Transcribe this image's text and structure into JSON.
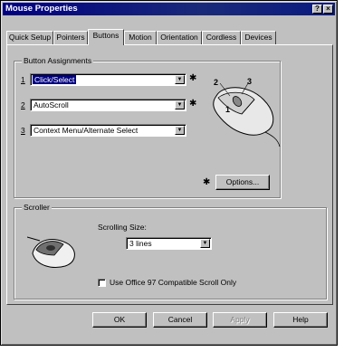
{
  "window": {
    "title": "Mouse Properties",
    "help_glyph": "?",
    "close_glyph": "×"
  },
  "tabs": [
    {
      "label": "Quick Setup"
    },
    {
      "label": "Pointers"
    },
    {
      "label": "Buttons"
    },
    {
      "label": "Motion"
    },
    {
      "label": "Orientation"
    },
    {
      "label": "Cordless"
    },
    {
      "label": "Devices"
    }
  ],
  "button_assignments": {
    "group_label": "Button Assignments",
    "rows": [
      {
        "number": "1",
        "value": "Click/Select"
      },
      {
        "number": "2",
        "value": "AutoScroll"
      },
      {
        "number": "3",
        "value": "Context Menu/Alternate Select"
      }
    ],
    "star_glyph": "✱",
    "options_label": "Options...",
    "diagram_labels": [
      "2",
      "3",
      "1"
    ]
  },
  "scroller": {
    "group_label": "Scroller",
    "scrolling_size_label": "Scrolling Size:",
    "scrolling_size_value": "3 lines",
    "checkbox_label": "Use Office 97 Compatible Scroll Only"
  },
  "footer": {
    "ok": "OK",
    "cancel": "Cancel",
    "apply": "Apply",
    "help": "Help"
  }
}
